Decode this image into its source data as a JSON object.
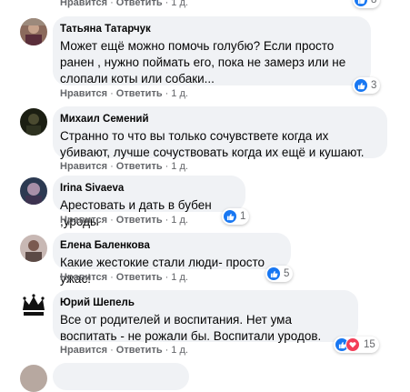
{
  "top_row": {
    "like": "Нравится",
    "reply": "Ответить",
    "time": "1 д.",
    "count": "8"
  },
  "comments": [
    {
      "author": "Татьяна Татарчук",
      "text": "Может ещё можно помочь голубю? Если просто ранен , нужно поймать его, пока не замерз или не слопали коты или собаки...",
      "like": "Нравится",
      "reply": "Ответить",
      "time": "1 д.",
      "reactions": {
        "types": [
          "like"
        ],
        "count": "3"
      },
      "avatar_icon": "user-photo-avatar"
    },
    {
      "author": "Михаил Семений",
      "text": "Странно то что вы только сочувствете когда их убивают, лучше сочуствовать когда их ещё и кушают.",
      "like": "Нравится",
      "reply": "Ответить",
      "time": "1 д.",
      "reactions": null,
      "avatar_icon": "user-photo-avatar"
    },
    {
      "author": "Irina Sivaeva",
      "text": "Арестовать и дать в бубен ,уроды",
      "like": "Нравится",
      "reply": "Ответить",
      "time": "1 д.",
      "reactions": {
        "types": [
          "like"
        ],
        "count": "1"
      },
      "avatar_icon": "user-photo-avatar"
    },
    {
      "author": "Елена Баленкова",
      "text": "Какие жестокие стали люди- просто ужас!",
      "like": "Нравится",
      "reply": "Ответить",
      "time": "1 д.",
      "reactions": {
        "types": [
          "like"
        ],
        "count": "5"
      },
      "avatar_icon": "user-photo-avatar"
    },
    {
      "author": "Юрий Шепель",
      "text": "Все от родителей и воспитания. Нет ума воспитать - не рожали бы. Воспитали уродов.",
      "like": "Нравится",
      "reply": "Ответить",
      "time": "1 д.",
      "reactions": {
        "types": [
          "like",
          "love"
        ],
        "count": "15"
      },
      "avatar_icon": "crown-avatar"
    }
  ],
  "colors": {
    "bubble": "#f0f2f5",
    "like": "#1877f2",
    "love": "#f33e58",
    "meta": "#65676b"
  }
}
